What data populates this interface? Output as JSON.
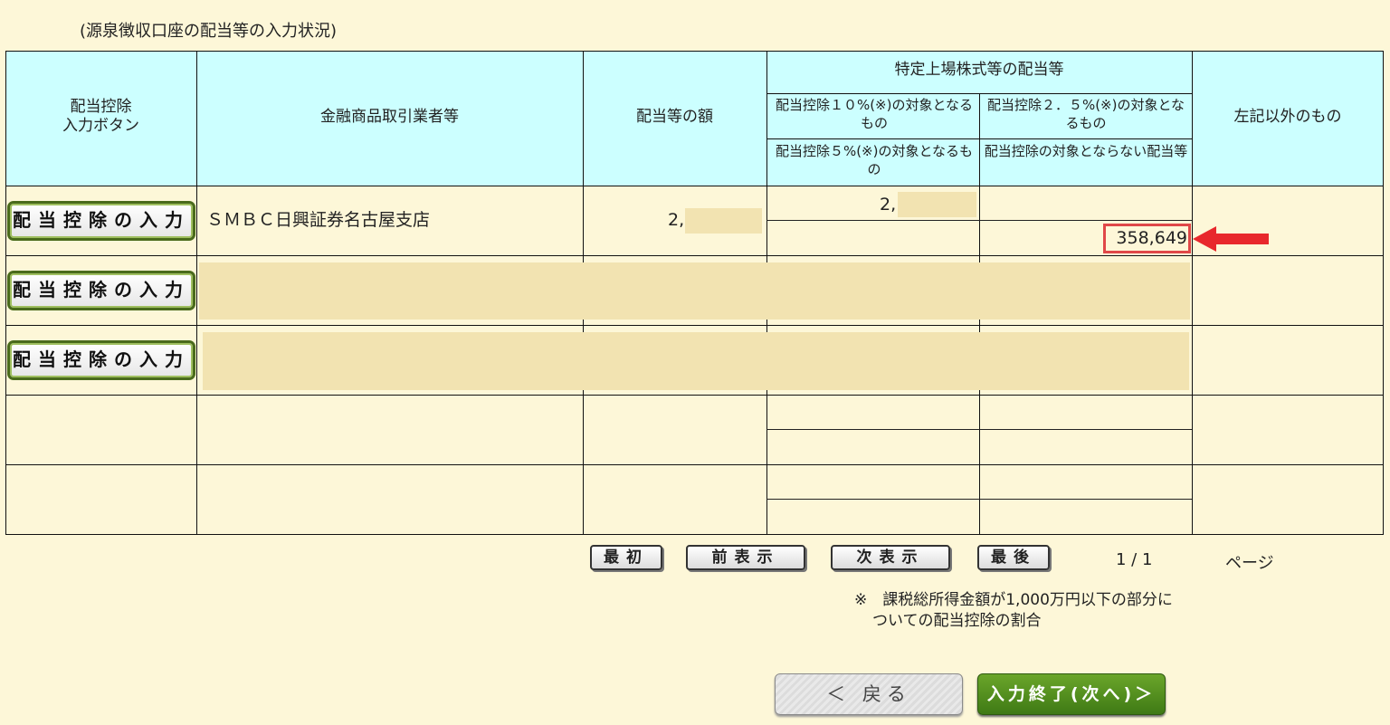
{
  "section_title": "(源泉徴収口座の配当等の入力状況)",
  "table": {
    "headers": {
      "button_col": "配当控除\n入力ボタン",
      "broker": "金融商品取引業者等",
      "amount": "配当等の額",
      "specific_group": "特定上場株式等の配当等",
      "ded10": "配当控除１０%(※)の対象となるもの",
      "ded25": "配当控除２．５%(※)の対象となるもの",
      "ded5": "配当控除５%(※)の対象となるもの",
      "no_ded": "配当控除の対象とならない配当等",
      "other": "左記以外のもの"
    },
    "rows": [
      {
        "button_label": "配当控除の入力",
        "broker": "ＳＭＢＣ日興証券名古屋支店",
        "amount_visible": "2,",
        "ded10_visible": "2,",
        "no_ded": "358,649"
      },
      {
        "button_label": "配当控除の入力"
      },
      {
        "button_label": "配当控除の入力"
      },
      {},
      {}
    ]
  },
  "pager": {
    "first": "最初",
    "prev": "前表示",
    "next": "次表示",
    "last": "最後",
    "page": "1 / 1",
    "page_unit": "ページ"
  },
  "note": {
    "line1": "※　課税総所得金額が1,000万円以下の部分に",
    "line2": "ついての配当控除の割合"
  },
  "nav": {
    "back": "＜ 戻る",
    "next": "入力終了(次へ)＞"
  },
  "colors": {
    "header_bg": "#ccffff",
    "page_bg": "#fdf7d8",
    "highlight": "#e04848",
    "next_button": "#4f8a1d"
  }
}
